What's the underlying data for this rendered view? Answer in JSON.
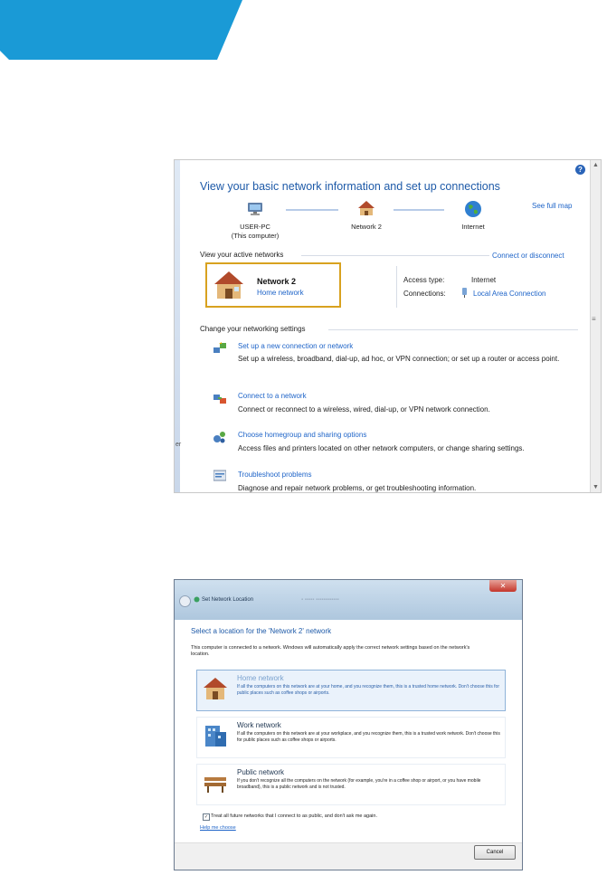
{
  "header": {
    "accent_color": "#1a9ad6"
  },
  "network_center": {
    "title": "View your basic network information and set up connections",
    "see_full_map": "See full map",
    "map": {
      "computer_name": "USER-PC",
      "computer_sub": "(This computer)",
      "network": "Network  2",
      "internet": "Internet"
    },
    "active_networks_heading": "View your active networks",
    "connect_disconnect": "Connect or disconnect",
    "active_network": {
      "name": "Network  2",
      "type": "Home network"
    },
    "access_type_label": "Access type:",
    "access_type_value": "Internet",
    "connections_label": "Connections:",
    "connections_value": "Local Area Connection",
    "settings_heading": "Change your networking settings",
    "tasks": [
      {
        "link": "Set up a new connection or network",
        "desc": "Set up a wireless, broadband, dial-up, ad hoc, or VPN connection; or set up a router or access point."
      },
      {
        "link": "Connect to a network",
        "desc": "Connect or reconnect to a wireless, wired, dial-up, or VPN network connection."
      },
      {
        "link": "Choose homegroup and sharing options",
        "desc": "Access files and printers located on other network computers, or change sharing settings."
      },
      {
        "link": "Troubleshoot problems",
        "desc": "Diagnose and repair network problems, or get troubleshooting information."
      }
    ],
    "strip_text": "er"
  },
  "set_location": {
    "window_title": "Set Network Location",
    "heading": "Select a location for the 'Network  2' network",
    "intro": "This computer is connected to a network. Windows will automatically apply the correct network settings based on the network's location.",
    "options": [
      {
        "title": "Home network",
        "desc": "If all the computers on this network are at your home, and you recognize them, this is a trusted home network.  Don't choose this for public places such as coffee shops or airports."
      },
      {
        "title": "Work network",
        "desc": "If all the computers on this network are at your workplace, and you recognize them, this is a trusted work network.  Don't choose this for public places such as coffee shops or airports."
      },
      {
        "title": "Public network",
        "desc": "If you don't recognize all the computers on the network (for example, you're in a coffee shop or airport, or you have mobile broadband), this is a public network and is not trusted."
      }
    ],
    "checkbox_label": "Treat all future networks that I connect to as public, and don't ask me again.",
    "help_link": "Help me choose",
    "cancel": "Cancel"
  }
}
